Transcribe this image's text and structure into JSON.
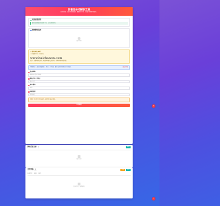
{
  "header": {
    "title": "抖音去水印解析工具",
    "subtitle": "支持抖音、快手等短视频、图集去水印，无需下载即可保存。"
  },
  "section1": {
    "title": "功能使用说明",
    "info": "复制视频链接后粘贴至下方，点击提取即可。",
    "placeholder": "暂无内容"
  },
  "section2": {
    "title": "视频解析结果",
    "placeholder": "暂无内容"
  },
  "notice": {
    "title": "本站永久网址",
    "line1": "请收藏本站，以免丢失",
    "url": "www.huichawen.com",
    "footer": "提示：如遇到解析失败，请更换链接后重新尝试，或联系客服反馈问题。"
  },
  "blue_bar": {
    "text": "温馨提示：支持批量解析，每行一个链接，最多支持同时解析多条视频。",
    "link": "查看教程"
  },
  "fields": [
    {
      "label": "作品链接",
      "placeholder": "请粘贴抖音分享链接"
    },
    {
      "label": "解析方式（可选）",
      "placeholder": "默认方式"
    },
    {
      "label": "保存格式",
      "placeholder": "MP4"
    },
    {
      "label": "画质选择",
      "placeholder": "高清画质"
    }
  ],
  "warn_bar": {
    "text": "提醒：仅供学习交流使用，请勿用于商业用途。"
  },
  "submit": {
    "label": "立即解析"
  },
  "history_panel": {
    "title": "解析历史记录",
    "count": "0",
    "button": "清空",
    "empty": "暂无记录"
  },
  "file_panel": {
    "title": "文件列表",
    "count": "0",
    "btn1": "刷新",
    "btn2": "导出",
    "tabs": [
      "全部文件",
      "视频",
      "图片"
    ],
    "empty": "暂无文件，请先解析"
  },
  "float": {
    "mid": "?",
    "bottom": "↑"
  },
  "colors": {
    "accent": "#ff3b5c",
    "teal": "#17b7ad",
    "orange": "#f5a623",
    "bg_top": "#7b52d6",
    "bg_bottom": "#3767e6"
  }
}
